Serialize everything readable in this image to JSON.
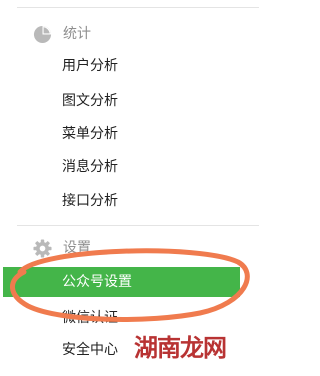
{
  "sections": [
    {
      "label": "统计",
      "icon": "pie-chart-icon",
      "items": [
        {
          "label": "用户分析"
        },
        {
          "label": "图文分析"
        },
        {
          "label": "菜单分析"
        },
        {
          "label": "消息分析"
        },
        {
          "label": "接口分析"
        }
      ]
    },
    {
      "label": "设置",
      "icon": "gear-icon",
      "items": [
        {
          "label": "公众号设置",
          "active": true
        },
        {
          "label": "微信认证"
        },
        {
          "label": "安全中心"
        }
      ]
    }
  ],
  "colors": {
    "active_bg": "#44b549",
    "annotation": "#f07b4e",
    "section_icon": "#b9b9b9"
  },
  "watermark": "湖南龙网"
}
